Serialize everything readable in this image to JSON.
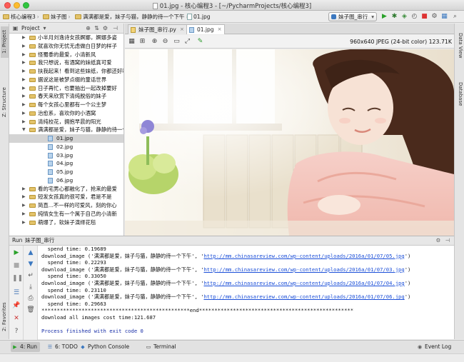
{
  "window": {
    "title": "01.jpg - 核心编程3 - [~/PycharmProjects/核心编程3]"
  },
  "navbar": {
    "crumbs": [
      "核心编程3",
      "妹子图",
      "满满都是爱，妹子与猫，静静的待一个下午",
      "01.jpg"
    ],
    "run_config": "妹子图_串行"
  },
  "left_stripe": {
    "project_tab": "1: Project",
    "structure_tab": "Z: Structure",
    "favorites_tab": "2: Favorites"
  },
  "right_stripe": {
    "data_view_tab": "Data View",
    "database_tab": "Database"
  },
  "project_panel": {
    "header_label": "Project",
    "tree": [
      {
        "label": "小半月刘逸诗女孩婀娜，婀娜多姿",
        "type": "folder"
      },
      {
        "label": "就喜欢你无忧无虑做白日梦的样子",
        "type": "folder"
      },
      {
        "label": "怪蜀黍的最爱，小清新风",
        "type": "folder"
      },
      {
        "label": "我只想说，有酒窝的妹纸真可爱",
        "type": "folder"
      },
      {
        "label": "扶我起来！看到这些妹纸，你都还好吗",
        "type": "folder"
      },
      {
        "label": "据说这是被梦点缀的童话世界",
        "type": "folder"
      },
      {
        "label": "日子再忙，也要抽出一起改掉要好",
        "type": "folder"
      },
      {
        "label": "春天来欣赏下清纯脱俗的妹子",
        "type": "folder"
      },
      {
        "label": "每个女孩心里都有一个公主梦",
        "type": "folder"
      },
      {
        "label": "治愈系，喜欢你的小酒窝",
        "type": "folder"
      },
      {
        "label": "清纯校花，拥抱早晨的阳光",
        "type": "folder"
      },
      {
        "label": "满满都是爱，妹子与猫，静静的待一个下午",
        "type": "folder",
        "expanded": true
      },
      {
        "label": "01.jpg",
        "type": "file",
        "selected": true
      },
      {
        "label": "02.jpg",
        "type": "file"
      },
      {
        "label": "03.jpg",
        "type": "file"
      },
      {
        "label": "04.jpg",
        "type": "file"
      },
      {
        "label": "05.jpg",
        "type": "file"
      },
      {
        "label": "06.jpg",
        "type": "file"
      },
      {
        "label": "看的宅男心都融化了，抢来的最爱",
        "type": "folder"
      },
      {
        "label": "短发女孩真的很可爱，君是不是",
        "type": "folder"
      },
      {
        "label": "简直...不一样的可爱风，刻的你心",
        "type": "folder"
      },
      {
        "label": "纯情女生有一个属于自己的小清新",
        "type": "folder"
      },
      {
        "label": "萌爆了，软妹子演绎花毯",
        "type": "folder"
      }
    ]
  },
  "editor": {
    "tabs": [
      {
        "label": "妹子图_串行.py",
        "icon": "python-file-icon"
      },
      {
        "label": "01.jpg",
        "icon": "image-file-icon",
        "active": true
      }
    ],
    "image_info": "960x640 JPEG (24-bit color) 123.71K"
  },
  "run_panel": {
    "header_label": "Run",
    "config_name": "妹子图_串行",
    "console": [
      {
        "text": "  spend time: 0.19689"
      },
      {
        "prefix": "download_image ('满满都是爱，妹子与猫，静静的待一个下午', '",
        "link": "http://mm.chinasareview.com/wp-content/uploads/2016a/01/07/05.jpg",
        "suffix": "')"
      },
      {
        "text": "  spend time: 0.22293"
      },
      {
        "prefix": "download_image ('满满都是爱，妹子与猫，静静的待一个下午', '",
        "link": "http://mm.chinasareview.com/wp-content/uploads/2016a/01/07/03.jpg",
        "suffix": "')"
      },
      {
        "text": "  spend time: 0.33050"
      },
      {
        "prefix": "download_image ('满满都是爱，妹子与猫，静静的待一个下午', '",
        "link": "http://mm.chinasareview.com/wp-content/uploads/2016a/01/07/04.jpg",
        "suffix": "')"
      },
      {
        "text": "  spend time: 0.23110"
      },
      {
        "prefix": "download_image ('满满都是爱，妹子与猫，静静的待一个下午', '",
        "link": "http://mm.chinasareview.com/wp-content/uploads/2016a/01/07/06.jpg",
        "suffix": "')"
      },
      {
        "text": "  spend time: 0.29663"
      },
      {
        "text": "************************************************end**************************************************"
      },
      {
        "text": "download all images cost time:121.687"
      },
      {
        "text": ""
      },
      {
        "text": "Process finished with exit code 0",
        "kind": "exit"
      }
    ]
  },
  "bottom_bar": {
    "tabs": [
      {
        "label": "4: Run",
        "icon": "run-icon",
        "active": true
      },
      {
        "label": "6: TODO",
        "icon": "todo-icon"
      },
      {
        "label": "Python Console",
        "icon": "python-console-icon"
      },
      {
        "label": "Terminal",
        "icon": "terminal-icon"
      }
    ],
    "event_log": "Event Log"
  },
  "colors": {
    "accent_link": "#1a4ed8",
    "run_green": "#2aa12a",
    "stop_red": "#d33"
  }
}
